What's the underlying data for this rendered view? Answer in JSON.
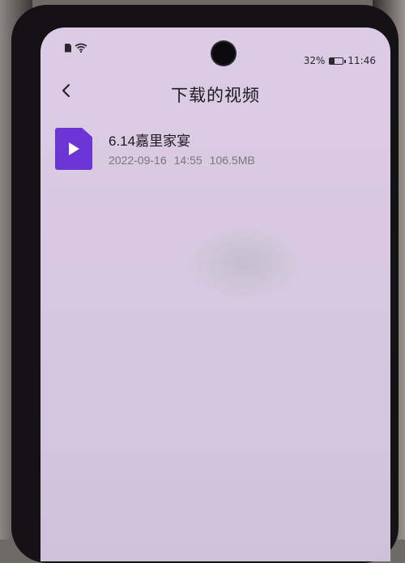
{
  "status_bar": {
    "battery_percent": "32%",
    "battery_level": 0.32,
    "time": "11:46",
    "left_icons": [
      "sim-icon",
      "wifi-icon"
    ]
  },
  "header": {
    "back_icon": "chevron-left-icon",
    "title": "下载的视频"
  },
  "videos": [
    {
      "name": "6.14嘉里家宴",
      "date": "2022-09-16",
      "time": "14:55",
      "size": "106.5MB",
      "icon": "video-file-icon"
    }
  ],
  "colors": {
    "screen_bg": "#d8c9e1",
    "file_icon": "#6a35d4",
    "title_text": "#1e1a22",
    "meta_text": "#7b7484"
  }
}
